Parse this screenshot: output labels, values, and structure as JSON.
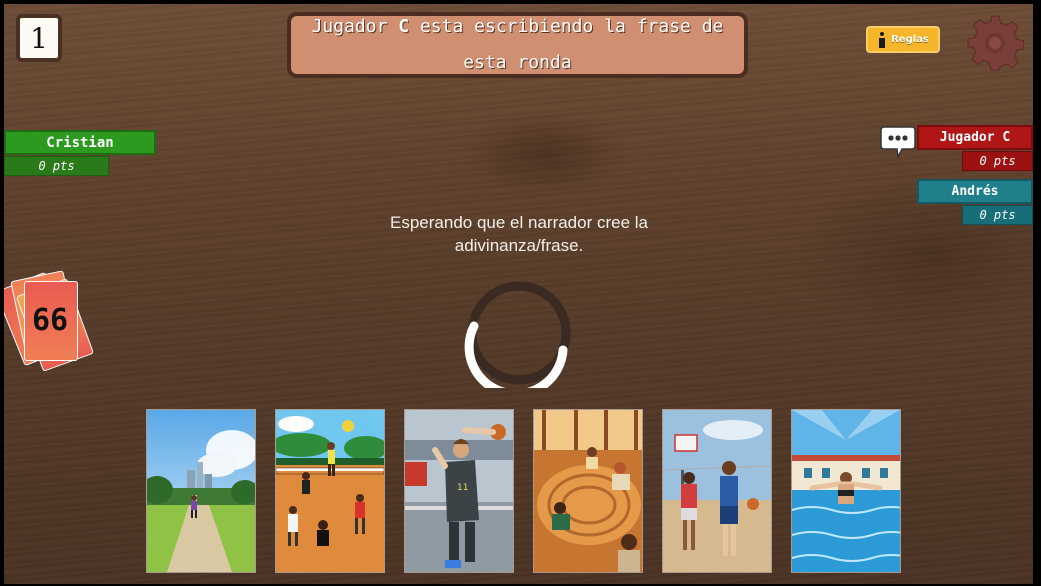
{
  "round": {
    "number": "1"
  },
  "banner": {
    "prefix": "Jugador ",
    "player": "C",
    "line1_rest": " esta escribiendo la frase de",
    "line2": "esta ronda"
  },
  "rules_button": {
    "label": "Reglas",
    "icon": "info-icon"
  },
  "settings_button": {
    "icon": "gear-icon"
  },
  "players": [
    {
      "name": "Cristian",
      "points": "0 pts",
      "color": "#2b9a1f",
      "pts_color": "#2a7a1a"
    },
    {
      "name": "Jugador C",
      "points": "0 pts",
      "color": "#b01616",
      "pts_color": "#9c1212",
      "typing": true
    },
    {
      "name": "Andrés",
      "points": "0 pts",
      "color": "#1f7f8a",
      "pts_color": "#186e78"
    }
  ],
  "status": {
    "message_line1": "Esperando que el narrador cree la",
    "message_line2": "adivinanza/frase."
  },
  "deck": {
    "count": "66",
    "colors": [
      "#ea5b52",
      "#f07f54",
      "#f5a950"
    ]
  },
  "hand": [
    {
      "scene": "park-runner"
    },
    {
      "scene": "volleyball"
    },
    {
      "scene": "basketball-shot"
    },
    {
      "scene": "meditation-circle"
    },
    {
      "scene": "basketball-players"
    },
    {
      "scene": "swimmer"
    }
  ]
}
